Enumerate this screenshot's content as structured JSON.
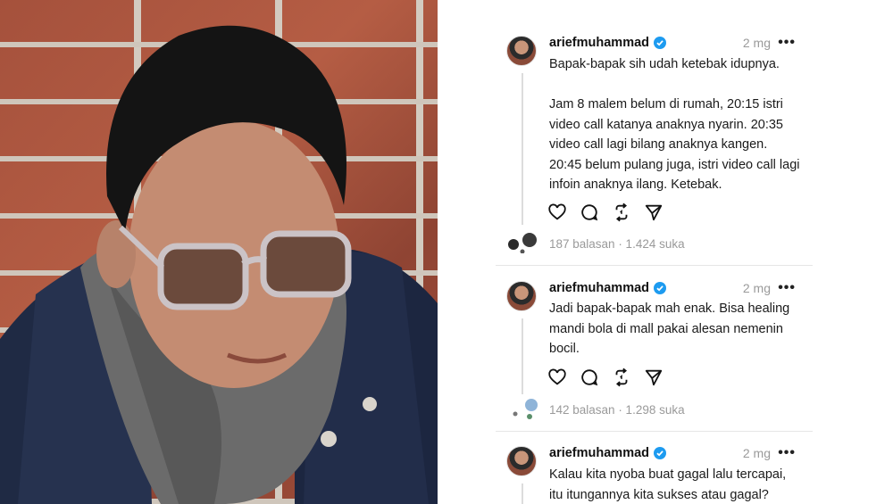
{
  "colors": {
    "verified_blue": "#1d9bf0",
    "muted_text": "#9a9a9a",
    "divider": "#e6e6e6"
  },
  "icons": {
    "like": "heart-icon",
    "reply": "comment-bubble-icon",
    "repost": "repost-icon",
    "share": "send-icon",
    "verified": "verified-badge-icon",
    "more": "more-dots-icon"
  },
  "posts": [
    {
      "username": "ariefmuhammad",
      "time": "2 mg",
      "more": "•••",
      "text": "Bapak-bapak sih udah ketebak idupnya.\n\nJam 8 malem belum di rumah, 20:15 istri\nvideo call katanya anaknya nyarin. 20:35\nvideo call lagi bilang anaknya kangen.\n20:45 belum pulang juga, istri video call lagi\ninfoin anaknya ilang. Ketebak.",
      "stats": "187 balasan · 1.424 suka"
    },
    {
      "username": "ariefmuhammad",
      "time": "2 mg",
      "more": "•••",
      "text": "Jadi bapak-bapak mah enak. Bisa healing\nmandi bola di mall pakai alesan nemenin\nbocil.",
      "stats": "142 balasan · 1.298 suka"
    },
    {
      "username": "ariefmuhammad",
      "time": "2 mg",
      "more": "•••",
      "text": "Kalau kita nyoba buat gagal lalu tercapai,\nitu itungannya kita sukses atau gagal?"
    }
  ]
}
